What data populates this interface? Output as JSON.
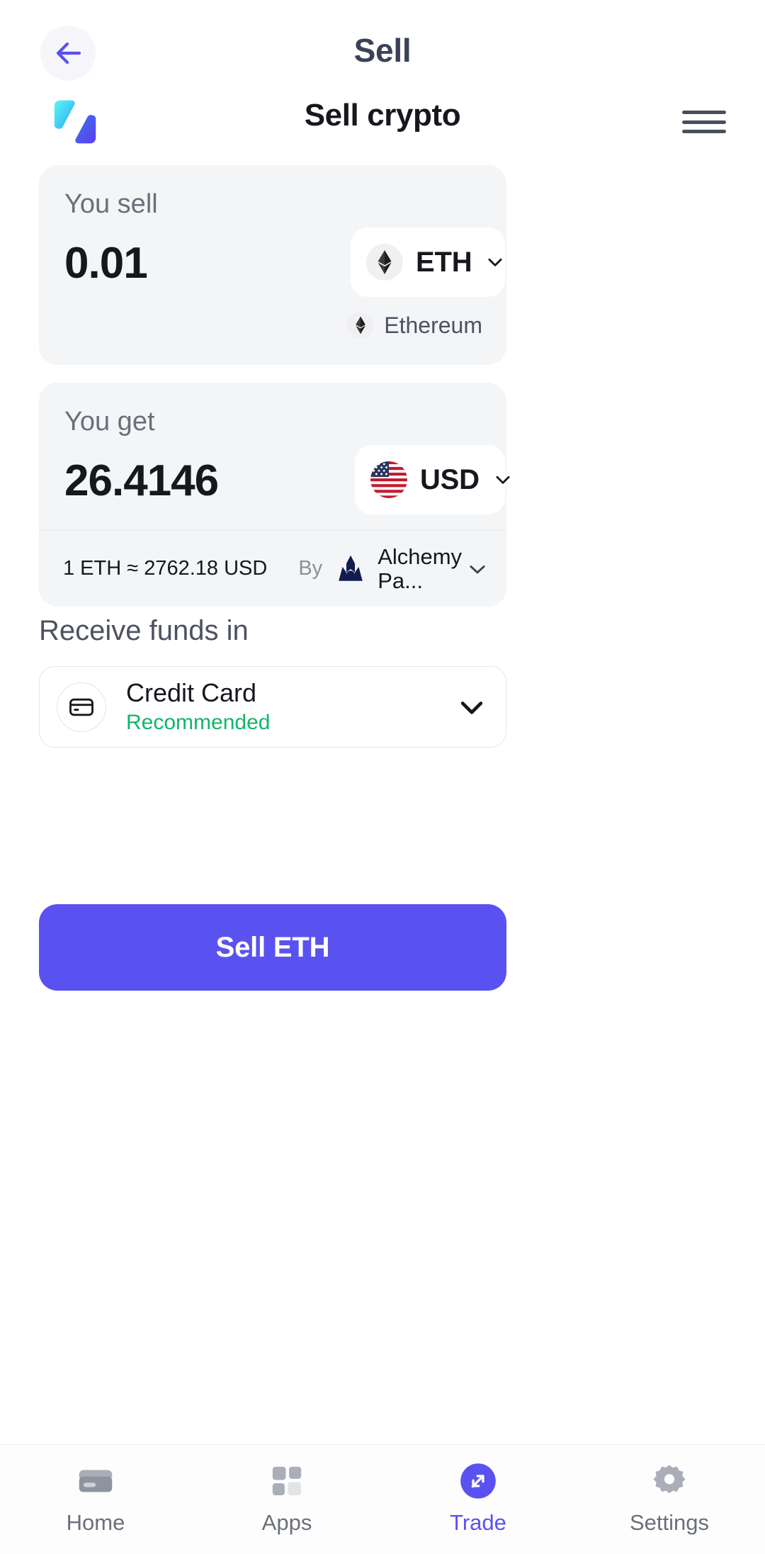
{
  "header": {
    "title": "Sell",
    "back_icon": "arrow-left-icon"
  },
  "brand": {
    "title": "Sell crypto",
    "logo_icon": "app-logo-icon",
    "menu_icon": "hamburger-menu-icon"
  },
  "sell_card": {
    "label": "You sell",
    "amount": "0.01",
    "asset_code": "ETH",
    "asset_icon": "ethereum-icon",
    "caret_icon": "chevron-down-icon",
    "network_name": "Ethereum",
    "network_icon": "ethereum-icon"
  },
  "get_card": {
    "label": "You get",
    "amount": "26.4146",
    "asset_code": "USD",
    "asset_icon": "usd-flag-icon",
    "caret_icon": "chevron-down-icon"
  },
  "rate": {
    "text": "1 ETH ≈ 2762.18 USD",
    "by_label": "By",
    "provider_name": "Alchemy Pa...",
    "provider_icon": "alchemy-pay-icon",
    "caret_icon": "chevron-down-icon"
  },
  "receive": {
    "section_title": "Receive funds in",
    "method_name": "Credit Card",
    "method_sub": "Recommended",
    "method_icon": "credit-card-icon",
    "caret_icon": "chevron-down-icon"
  },
  "cta": {
    "label": "Sell ETH"
  },
  "bottom_nav": {
    "items": [
      {
        "label": "Home",
        "icon": "wallet-icon",
        "active": false
      },
      {
        "label": "Apps",
        "icon": "grid-apps-icon",
        "active": false
      },
      {
        "label": "Trade",
        "icon": "trade-arrows-icon",
        "active": true
      },
      {
        "label": "Settings",
        "icon": "gear-icon",
        "active": false
      }
    ]
  },
  "colors": {
    "accent": "#5a52f0",
    "recommended": "#13b56a",
    "card_bg": "#f4f5f7",
    "provider": "#131c4e"
  }
}
